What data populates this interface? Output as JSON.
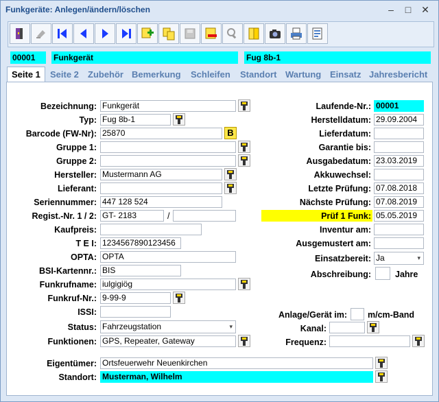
{
  "window": {
    "title": "Funkgeräte: Anlegen/ändern/löschen"
  },
  "header": {
    "id": "00001",
    "name": "Funkgerät",
    "type": "Fug  8b-1"
  },
  "tabs": [
    "Seite 1",
    "Seite 2",
    "Zubehör",
    "Bemerkung",
    "Schleifen",
    "Standort",
    "Wartung",
    "Einsatz",
    "Jahresbericht"
  ],
  "left": {
    "bezeichnung": {
      "label": "Bezeichnung:",
      "value": "Funkgerät"
    },
    "typ": {
      "label": "Typ:",
      "value": "Fug  8b-1"
    },
    "barcode": {
      "label": "Barcode (FW-Nr):",
      "value": "25870",
      "button": "B"
    },
    "gruppe1": {
      "label": "Gruppe 1:",
      "value": ""
    },
    "gruppe2": {
      "label": "Gruppe 2:",
      "value": ""
    },
    "hersteller": {
      "label": "Hersteller:",
      "value": "Mustermann AG"
    },
    "lieferant": {
      "label": "Lieferant:",
      "value": ""
    },
    "seriennummer": {
      "label": "Seriennummer:",
      "value": "447 128 524"
    },
    "regist": {
      "label": "Regist.-Nr. 1 / 2:",
      "value1": "GT- 2183",
      "separator": "/",
      "value2": ""
    },
    "kaufpreis": {
      "label": "Kaufpreis:",
      "value": ""
    },
    "tei": {
      "label": "T E I:",
      "value": "1234567890123456"
    },
    "opta": {
      "label": "OPTA:",
      "value": "OPTA"
    },
    "bsi": {
      "label": "BSI-Kartennr.:",
      "value": "BIS"
    },
    "funkrufname": {
      "label": "Funkrufname:",
      "value": "iulgigiög"
    },
    "funkrufnr": {
      "label": "Funkruf-Nr.:",
      "value": "9-99-9"
    },
    "issi": {
      "label": "ISSI:",
      "value": ""
    },
    "status": {
      "label": "Status:",
      "value": "Fahrzeugstation"
    },
    "funktionen": {
      "label": "Funktionen:",
      "value": "GPS, Repeater, Gateway"
    },
    "eigentuemer": {
      "label": "Eigentümer:",
      "value": "Ortsfeuerwehr Neuenkirchen"
    },
    "standort": {
      "label": "Standort:",
      "value": "Musterman, Wilhelm"
    }
  },
  "right": {
    "laufende": {
      "label": "Laufende-Nr.:",
      "value": "00001"
    },
    "herstelldatum": {
      "label": "Herstelldatum:",
      "value": "29.09.2004"
    },
    "lieferdatum": {
      "label": "Lieferdatum:",
      "value": ""
    },
    "garantie": {
      "label": "Garantie bis:",
      "value": ""
    },
    "ausgabedatum": {
      "label": "Ausgabedatum:",
      "value": "23.03.2019"
    },
    "akkuwechsel": {
      "label": "Akkuwechsel:",
      "value": ""
    },
    "letzte": {
      "label": "Letzte Prüfung:",
      "value": "07.08.2018"
    },
    "naechste": {
      "label": "Nächste Prüfung:",
      "value": "07.08.2019"
    },
    "pruef": {
      "label": "Prüf 1 Funk:",
      "value": "05.05.2019"
    },
    "inventur": {
      "label": "Inventur am:",
      "value": ""
    },
    "ausgemustert": {
      "label": "Ausgemustert am:",
      "value": ""
    },
    "einsatzbereit": {
      "label": "Einsatzbereit:",
      "value": "Ja"
    },
    "abschreibung": {
      "label": "Abschreibung:",
      "value": "",
      "unit": "Jahre"
    },
    "anlage": {
      "label": "Anlage/Gerät im:",
      "value": "",
      "unit": "m/cm-Band"
    },
    "kanal": {
      "label": "Kanal:",
      "value": ""
    },
    "frequenz": {
      "label": "Frequenz:",
      "value": ""
    }
  },
  "colors": {
    "accent": "#00ffff",
    "highlight": "#ffff00",
    "tab_text": "#5a7fb0"
  }
}
